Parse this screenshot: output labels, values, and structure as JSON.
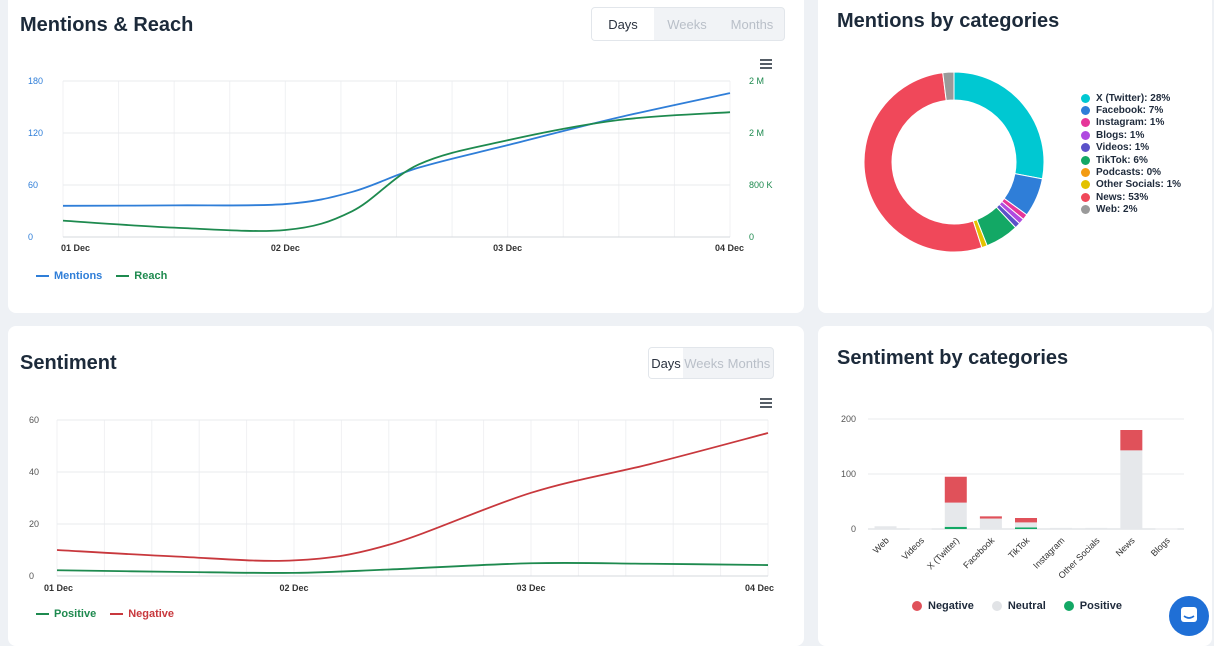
{
  "mentions_reach": {
    "title": "Mentions & Reach",
    "ranges": [
      "Days",
      "Weeks",
      "Months"
    ],
    "active_range": "Days",
    "legend": [
      {
        "name": "Mentions",
        "color": "#2f7ed8"
      },
      {
        "name": "Reach",
        "color": "#1e8a4f"
      }
    ]
  },
  "mentions_categories": {
    "title": "Mentions by categories",
    "legend": [
      {
        "label": "X (Twitter): 28%",
        "color": "#00c8d2"
      },
      {
        "label": "Facebook: 7%",
        "color": "#2f7ed8"
      },
      {
        "label": "Instagram: 1%",
        "color": "#e6369a"
      },
      {
        "label": "Blogs: 1%",
        "color": "#b04ae0"
      },
      {
        "label": "Videos: 1%",
        "color": "#5b52c9"
      },
      {
        "label": "TikTok: 6%",
        "color": "#13a865"
      },
      {
        "label": "Podcasts: 0%",
        "color": "#f39b12"
      },
      {
        "label": "Other Socials: 1%",
        "color": "#e3c200"
      },
      {
        "label": "News: 53%",
        "color": "#f0485a"
      },
      {
        "label": "Web: 2%",
        "color": "#9a9a9a"
      }
    ]
  },
  "sentiment": {
    "title": "Sentiment",
    "ranges": [
      "Days",
      "Weeks",
      "Months"
    ],
    "active_range": "Days",
    "legend": [
      {
        "name": "Positive",
        "color": "#1e8a4f"
      },
      {
        "name": "Negative",
        "color": "#c8383d"
      }
    ]
  },
  "sentiment_categories": {
    "title": "Sentiment by categories",
    "legend": [
      {
        "name": "Negative",
        "color": "#e0515a"
      },
      {
        "name": "Neutral",
        "color": "#e6e8eb"
      },
      {
        "name": "Positive",
        "color": "#13a865"
      }
    ]
  },
  "chart_data": [
    {
      "type": "line",
      "x": [
        "01 Dec",
        "02 Dec",
        "03 Dec",
        "04 Dec"
      ],
      "yticks_left": [
        "0",
        "60",
        "120",
        "180"
      ],
      "yticks_right": [
        "0",
        "800 K",
        "2 M",
        "2 M"
      ],
      "ylim": [
        0,
        180
      ],
      "series": [
        {
          "name": "Mentions",
          "axis": "left",
          "x": [
            0,
            0.5,
            1,
            1.3,
            1.6,
            2,
            2.5,
            3
          ],
          "y": [
            36,
            36.5,
            38,
            52,
            80,
            106,
            138,
            166
          ]
        },
        {
          "name": "Reach",
          "axis": "right",
          "x": [
            0,
            0.5,
            1,
            1.3,
            1.6,
            2,
            2.5,
            3
          ],
          "y": [
            210000,
            120000,
            90000,
            330000,
            930000,
            1240000,
            1500000,
            1600000
          ]
        }
      ]
    },
    {
      "type": "pie",
      "categories": [
        "X (Twitter)",
        "Facebook",
        "Instagram",
        "Blogs",
        "Videos",
        "TikTok",
        "Podcasts",
        "Other Socials",
        "News",
        "Web"
      ],
      "values": [
        28,
        7,
        1,
        1,
        1,
        6,
        0,
        1,
        53,
        2
      ]
    },
    {
      "type": "line",
      "x": [
        "01 Dec",
        "02 Dec",
        "03 Dec",
        "04 Dec"
      ],
      "yticks": [
        "0",
        "20",
        "40",
        "60"
      ],
      "ylim": [
        0,
        60
      ],
      "series": [
        {
          "name": "Positive",
          "x": [
            0,
            0.5,
            1,
            1.4,
            2,
            2.5,
            3
          ],
          "y": [
            2.2,
            1.6,
            1.2,
            2.5,
            4.9,
            4.7,
            4.2
          ]
        },
        {
          "name": "Negative",
          "x": [
            0,
            0.5,
            1,
            1.4,
            2,
            2.5,
            3
          ],
          "y": [
            10,
            7.5,
            6,
            12,
            32,
            43,
            55
          ]
        }
      ]
    },
    {
      "type": "bar",
      "categories": [
        "Web",
        "Videos",
        "X (Twitter)",
        "Facebook",
        "TikTok",
        "Instagram",
        "Other Socials",
        "News",
        "Blogs"
      ],
      "yticks": [
        "0",
        "100",
        "200"
      ],
      "ylim": [
        0,
        200
      ],
      "series": [
        {
          "name": "Positive",
          "values": [
            0,
            0,
            4,
            0,
            3,
            0,
            0,
            0,
            0
          ]
        },
        {
          "name": "Neutral",
          "values": [
            5,
            1,
            44,
            19,
            9,
            2,
            2,
            143,
            1
          ]
        },
        {
          "name": "Negative",
          "values": [
            0,
            0,
            47,
            4,
            8,
            0,
            0,
            37,
            0
          ]
        }
      ]
    }
  ]
}
